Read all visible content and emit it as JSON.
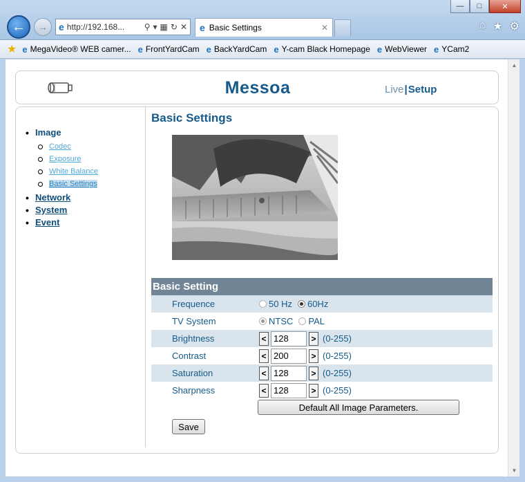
{
  "browser": {
    "address_url": "http://192.168...",
    "tab_title": "Basic Settings",
    "favorites": [
      "MegaVideo® WEB camer...",
      "FrontYardCam",
      "BackYardCam",
      "Y-cam Black Homepage",
      "WebViewer",
      "YCam2"
    ]
  },
  "header": {
    "brand": "Messoa",
    "nav_live": "Live",
    "nav_sep": "|",
    "nav_setup": "Setup"
  },
  "sidebar": {
    "image": "Image",
    "image_sub": [
      "Codec",
      "Exposure",
      "White Balance",
      "Basic Settings"
    ],
    "network": "Network",
    "system": "System",
    "event": "Event"
  },
  "main": {
    "title": "Basic Settings",
    "section_title": "Basic Setting",
    "frequence": {
      "label": "Frequence",
      "opt1": "50 Hz",
      "opt2": "60Hz",
      "selected": "60Hz"
    },
    "tv_system": {
      "label": "TV System",
      "opt1": "NTSC",
      "opt2": "PAL",
      "selected": "NTSC"
    },
    "brightness": {
      "label": "Brightness",
      "value": "128",
      "range": "(0-255)"
    },
    "contrast": {
      "label": "Contrast",
      "value": "200",
      "range": "(0-255)"
    },
    "saturation": {
      "label": "Saturation",
      "value": "128",
      "range": "(0-255)"
    },
    "sharpness": {
      "label": "Sharpness",
      "value": "128",
      "range": "(0-255)"
    },
    "step_dec": "<",
    "step_inc": ">",
    "default_button": "Default All Image Parameters.",
    "save_button": "Save"
  }
}
